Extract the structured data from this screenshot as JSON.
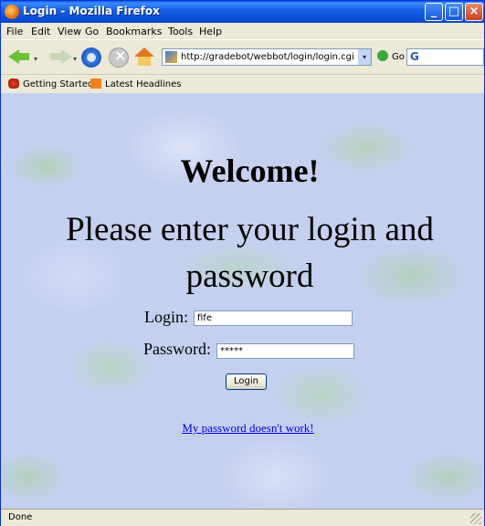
{
  "window": {
    "title": "Login - Mozilla Firefox"
  },
  "menu": {
    "items": [
      "File",
      "Edit",
      "View",
      "Go",
      "Bookmarks",
      "Tools",
      "Help"
    ]
  },
  "navbar": {
    "url": "http://gradebot/webbot/login/login.cgi",
    "go_label": "Go",
    "search_icon": "google-g"
  },
  "bookmarks": {
    "items": [
      "Getting Started",
      "Latest Headlines"
    ]
  },
  "page": {
    "welcome": "Welcome!",
    "prompt": "Please enter your login and password",
    "login_label": "Login:",
    "login_value": "fife",
    "password_label": "Password:",
    "password_value": "*****",
    "submit_label": "Login",
    "help_link": "My password doesn't work!"
  },
  "status": {
    "text": "Done"
  },
  "colors": {
    "titlebar": "#0a5ae8",
    "link": "#0000ee",
    "background": "#c5d0f0"
  }
}
